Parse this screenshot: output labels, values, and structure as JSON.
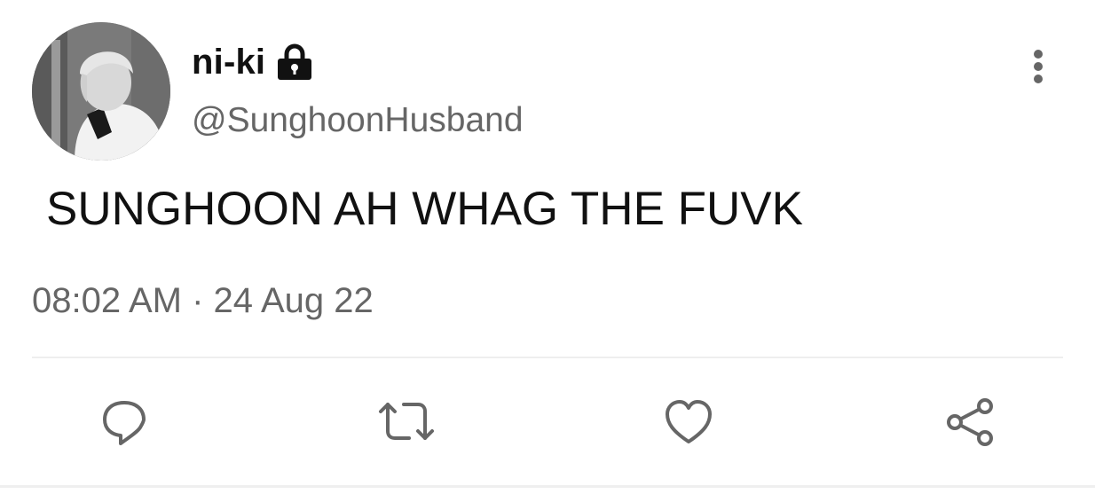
{
  "tweet": {
    "display_name": "ni-ki",
    "handle": "@SunghoonHusband",
    "text": "SUNGHOON AH WHAG THE FUVK",
    "timestamp": "08:02 AM · 24 Aug 22"
  },
  "icons": {
    "protected": "lock-icon",
    "menu": "more-vertical-icon",
    "actions": [
      "reply-icon",
      "retweet-icon",
      "like-icon",
      "share-icon"
    ]
  },
  "colors": {
    "text": "#111111",
    "secondary_text": "#666666",
    "icon": "#666666",
    "divider": "#eeeeee",
    "background": "#ffffff"
  }
}
